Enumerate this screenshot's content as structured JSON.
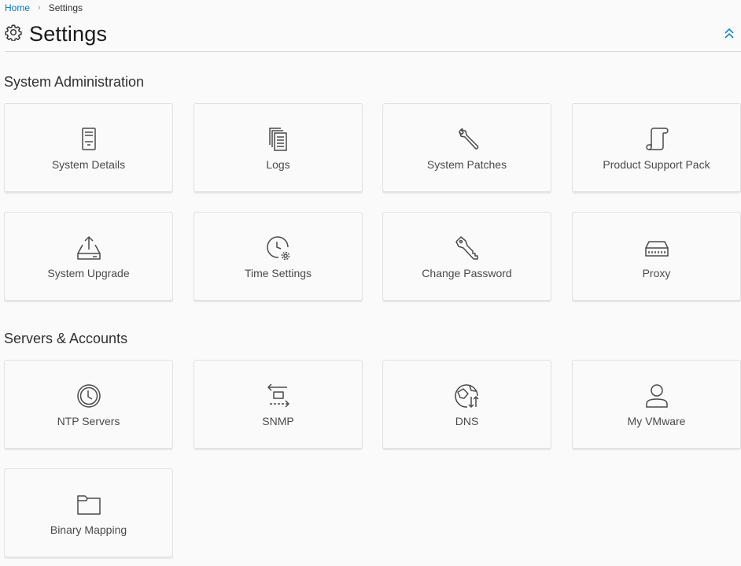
{
  "breadcrumb": {
    "home": "Home",
    "separator": "›",
    "current": "Settings"
  },
  "header": {
    "title": "Settings",
    "title_icon": "gear-icon",
    "collapse_icon": "double-chevron-up-icon"
  },
  "colors": {
    "link": "#0079b8",
    "icon_stroke": "#4a4a4a",
    "card_border": "#e1e1e1"
  },
  "sections": [
    {
      "title": "System Administration",
      "cards": [
        {
          "label": "System Details",
          "icon": "server-icon"
        },
        {
          "label": "Logs",
          "icon": "documents-icon"
        },
        {
          "label": "System Patches",
          "icon": "wrench-icon"
        },
        {
          "label": "Product Support Pack",
          "icon": "scroll-icon"
        },
        {
          "label": "System Upgrade",
          "icon": "upload-tray-icon"
        },
        {
          "label": "Time Settings",
          "icon": "clock-gear-icon"
        },
        {
          "label": "Change Password",
          "icon": "key-icon"
        },
        {
          "label": "Proxy",
          "icon": "network-device-icon"
        }
      ]
    },
    {
      "title": "Servers & Accounts",
      "cards": [
        {
          "label": "NTP Servers",
          "icon": "clock-icon"
        },
        {
          "label": "SNMP",
          "icon": "transfer-arrows-icon"
        },
        {
          "label": "DNS",
          "icon": "globe-arrows-icon"
        },
        {
          "label": "My VMware",
          "icon": "user-icon"
        },
        {
          "label": "Binary Mapping",
          "icon": "folder-icon"
        }
      ]
    }
  ]
}
